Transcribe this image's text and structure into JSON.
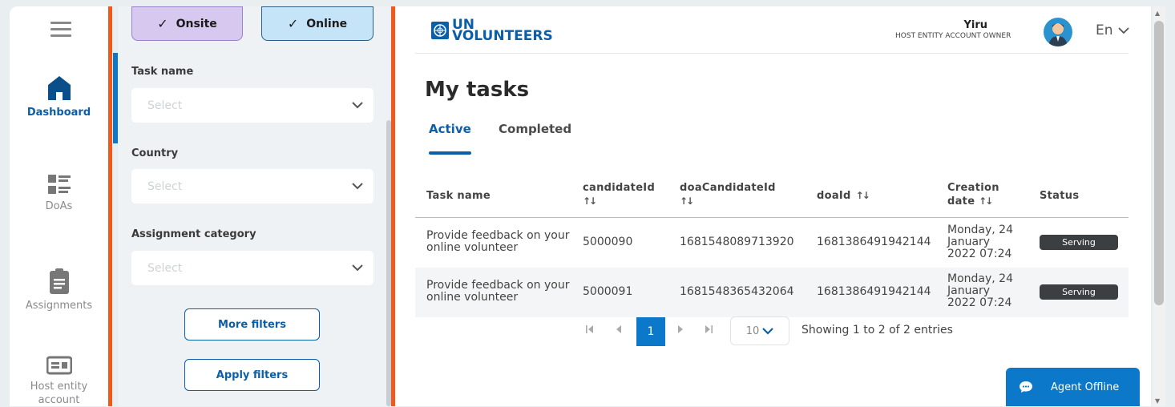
{
  "nav": {
    "items": [
      {
        "label": "Dashboard",
        "icon": "home-icon",
        "active": true
      },
      {
        "label": "DoAs",
        "icon": "list-icon",
        "active": false
      },
      {
        "label": "Assignments",
        "icon": "clipboard-icon",
        "active": false
      },
      {
        "label": "Host entity account",
        "icon": "id-card-icon",
        "active": false
      }
    ]
  },
  "filters": {
    "chips": [
      {
        "label": "Onsite",
        "checked": true
      },
      {
        "label": "Online",
        "checked": true
      }
    ],
    "task_name": {
      "label": "Task name",
      "placeholder": "Select"
    },
    "country": {
      "label": "Country",
      "placeholder": "Select"
    },
    "assignment_category": {
      "label": "Assignment category",
      "placeholder": "Select"
    },
    "more_filters": "More filters",
    "apply_filters": "Apply filters"
  },
  "header": {
    "logo_line1": "UN",
    "logo_line2": "VOLUNTEERS",
    "user_name": "Yiru",
    "user_role": "HOST ENTITY ACCOUNT OWNER",
    "language": "En"
  },
  "main": {
    "title": "My tasks",
    "tabs": [
      {
        "label": "Active",
        "active": true
      },
      {
        "label": "Completed",
        "active": false
      }
    ],
    "table": {
      "columns": [
        "Task name",
        "candidateId",
        "doaCandidateId",
        "doaId",
        "Creation date",
        "Status"
      ],
      "rows": [
        {
          "task": "Provide feedback on your online volunteer",
          "candidateId": "5000090",
          "doaCandidateId": "1681548089713920",
          "doaId": "1681386491942144",
          "date": "Monday, 24 January 2022 07:24",
          "status": "Serving"
        },
        {
          "task": "Provide feedback on your online volunteer",
          "candidateId": "5000091",
          "doaCandidateId": "1681548365432064",
          "doaId": "1681386491942144",
          "date": "Monday, 24 January 2022 07:24",
          "status": "Serving"
        }
      ]
    },
    "pagination": {
      "current_page": "1",
      "page_size": "10",
      "summary": "Showing 1 to 2 of 2 entries"
    }
  },
  "chat": {
    "label": "Agent Offline"
  },
  "colors": {
    "primary": "#0b78c9",
    "accent": "#ef5a1c",
    "onsite_chip": "#d7c8ef",
    "online_chip": "#c6e4f8",
    "badge": "#3c3f42"
  }
}
